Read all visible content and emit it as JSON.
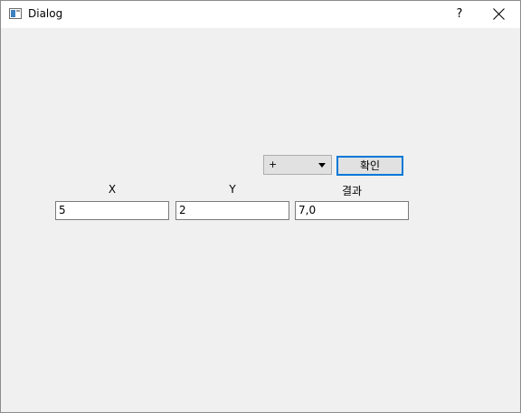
{
  "window": {
    "title": "Dialog",
    "help_label": "?"
  },
  "form": {
    "operator_selected": "+",
    "confirm_label": "확인",
    "x_label": "X",
    "y_label": "Y",
    "result_label": "결과",
    "x_value": "5",
    "y_value": "2",
    "result_value": "7,0"
  },
  "colors": {
    "accent": "#0078d7",
    "window_bg": "#f0f0f0",
    "titlebar_bg": "#ffffff"
  }
}
